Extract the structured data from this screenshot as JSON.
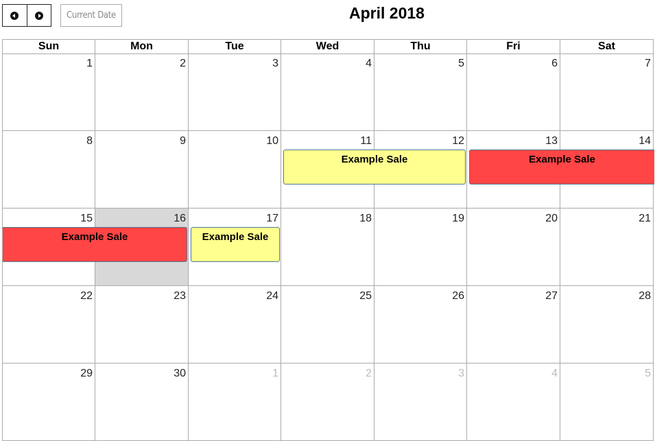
{
  "toolbar": {
    "prev_icon": "chevron-left-circle-icon",
    "next_icon": "chevron-right-circle-icon",
    "today_label": "Current Date",
    "title": "April 2018"
  },
  "weekdays": [
    "Sun",
    "Mon",
    "Tue",
    "Wed",
    "Thu",
    "Fri",
    "Sat"
  ],
  "weeks": [
    {
      "days": [
        "1",
        "2",
        "3",
        "4",
        "5",
        "6",
        "7"
      ]
    },
    {
      "days": [
        "8",
        "9",
        "10",
        "11",
        "12",
        "13",
        "14"
      ]
    },
    {
      "days": [
        "15",
        "16",
        "17",
        "18",
        "19",
        "20",
        "21"
      ]
    },
    {
      "days": [
        "22",
        "23",
        "24",
        "25",
        "26",
        "27",
        "28"
      ]
    },
    {
      "days": [
        "29",
        "30",
        "1",
        "2",
        "3",
        "4",
        "5"
      ]
    }
  ],
  "today": "16",
  "events": [
    {
      "title": "Example Sale",
      "color": "#ffff8f",
      "dates": "Apr 11 - Apr 12"
    },
    {
      "title": "Example Sale",
      "color": "#ff4545",
      "dates": "Apr 13 - Apr 16"
    },
    {
      "title": "Example Sale",
      "color": "#ff4545",
      "dates": "Apr 13 - Apr 16"
    },
    {
      "title": "Example Sale",
      "color": "#ffff8f",
      "dates": "Apr 17"
    }
  ]
}
